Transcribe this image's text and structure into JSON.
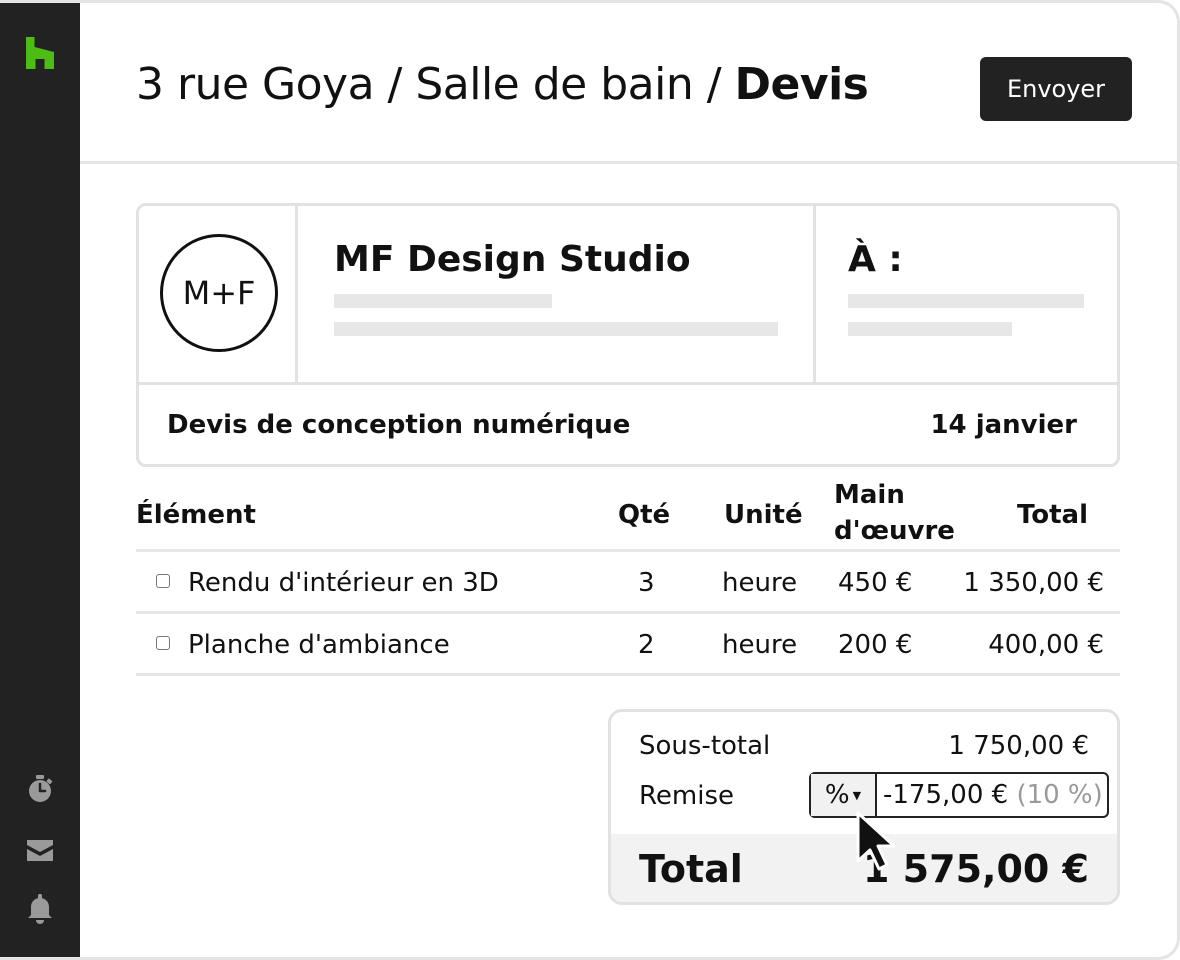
{
  "header": {
    "breadcrumb": [
      {
        "label": "3 rue Goya",
        "separator": " / "
      },
      {
        "label": "Salle de bain",
        "separator": " / "
      },
      {
        "label": "Devis"
      }
    ],
    "send_label": "Envoyer"
  },
  "sidebar": {
    "logo_icon": "houzz-logo-icon",
    "logo_color": "#4dbc15",
    "items": [
      {
        "icon": "stopwatch-icon"
      },
      {
        "icon": "inbox-icon"
      },
      {
        "icon": "bell-icon"
      }
    ]
  },
  "quote": {
    "logo_text": "M+F",
    "from_name": "MF Design Studio",
    "to_label": "À :",
    "title": "Devis de conception numérique",
    "date": "14 janvier"
  },
  "items_table": {
    "columns": {
      "item": "Élément",
      "qty": "Qté",
      "unit": "Unité",
      "labor_line1": "Main",
      "labor_line2": "d'œuvre",
      "total": "Total"
    },
    "rows": [
      {
        "name": "Rendu d'intérieur en 3D",
        "qty": "3",
        "unit": "heure",
        "labor": "450 €",
        "total": "1 350,00 €"
      },
      {
        "name": "Planche d'ambiance",
        "qty": "2",
        "unit": "heure",
        "labor": "200 €",
        "total": "400,00 €"
      }
    ]
  },
  "summary": {
    "subtotal_label": "Sous-total",
    "subtotal_value": "1 750,00 €",
    "discount_label": "Remise",
    "discount_type": "%",
    "discount_value": "-175,00 €",
    "discount_percent": "(10 %)",
    "total_label": "Total",
    "total_value": "1 575,00 €"
  },
  "colors": {
    "sidebar": "#222222",
    "accent": "#4dbc15",
    "button": "#222222",
    "border": "#e2e2e2"
  }
}
